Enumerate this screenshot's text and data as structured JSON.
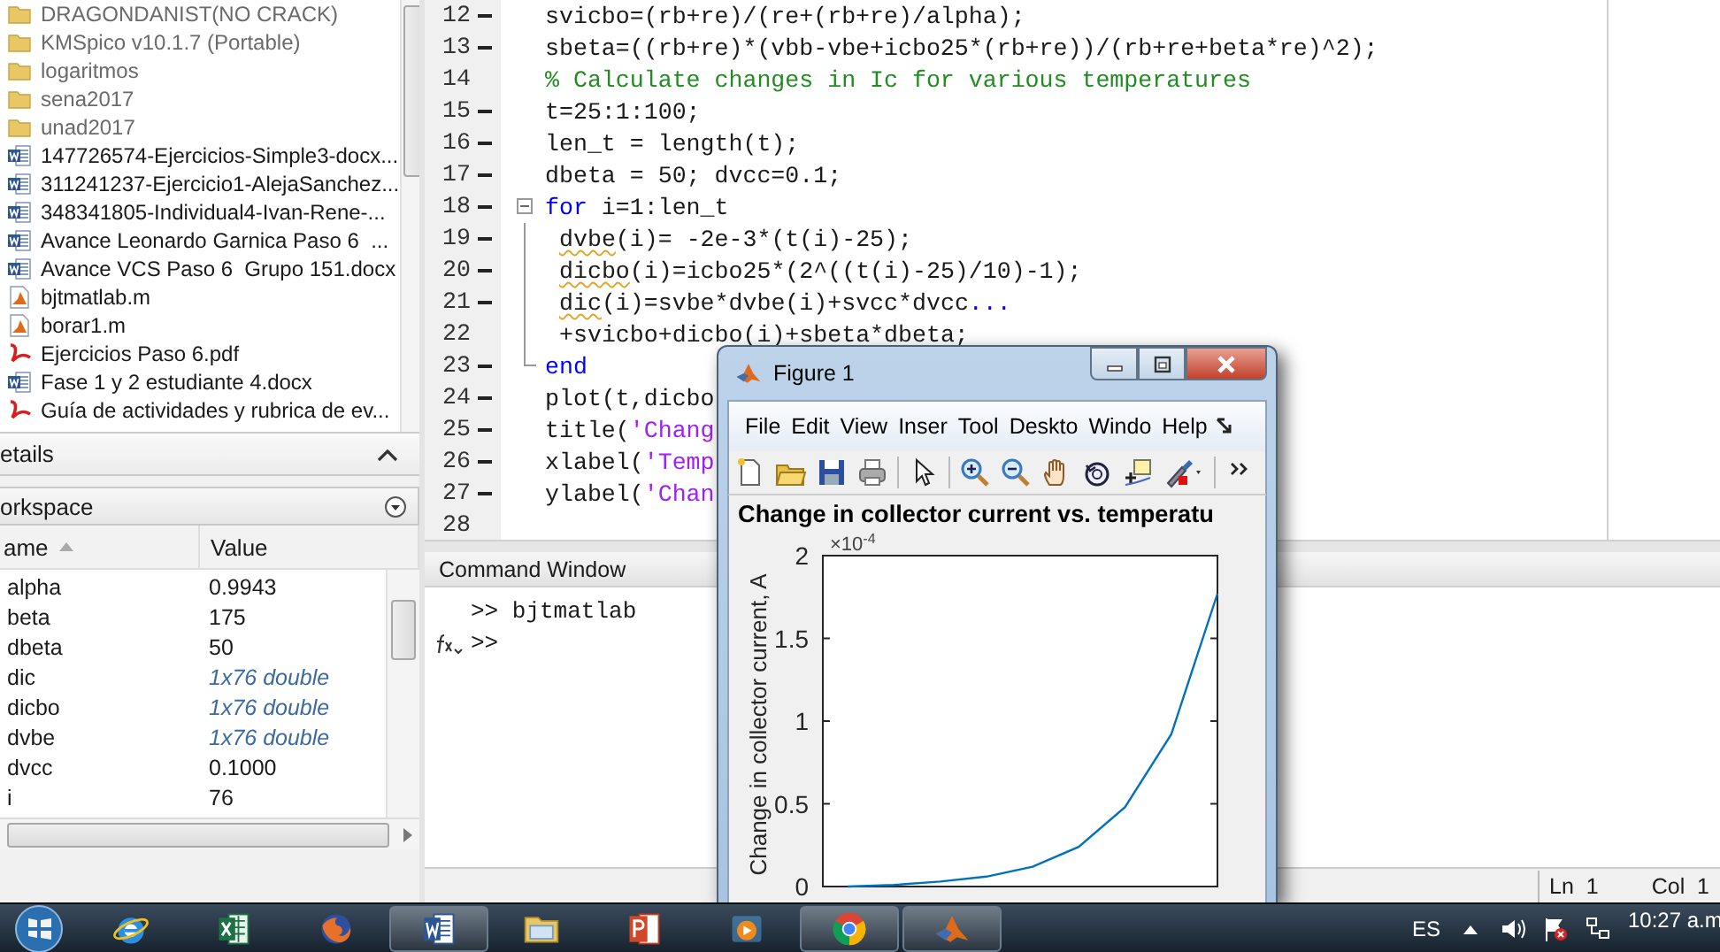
{
  "file_browser": {
    "items": [
      {
        "name": "DRAGONDANIST(NO CRACK)",
        "kind": "folder"
      },
      {
        "name": "KMSpico v10.1.7 (Portable)",
        "kind": "folder"
      },
      {
        "name": "logaritmos",
        "kind": "folder"
      },
      {
        "name": "sena2017",
        "kind": "folder"
      },
      {
        "name": "unad2017",
        "kind": "folder"
      },
      {
        "name": "147726574-Ejercicios-Simple3-docx...",
        "kind": "word"
      },
      {
        "name": "311241237-Ejercicio1-AlejaSanchez...",
        "kind": "word"
      },
      {
        "name": "348341805-Individual4-Ivan-Rene-...",
        "kind": "word"
      },
      {
        "name": "Avance Leonardo Garnica Paso 6  ...",
        "kind": "word"
      },
      {
        "name": "Avance VCS Paso 6  Grupo 151.docx",
        "kind": "word"
      },
      {
        "name": "bjtmatlab.m",
        "kind": "script"
      },
      {
        "name": "borar1.m",
        "kind": "script"
      },
      {
        "name": "Ejercicios Paso 6.pdf",
        "kind": "pdf"
      },
      {
        "name": "Fase 1 y 2 estudiante 4.docx",
        "kind": "word"
      },
      {
        "name": "Guía de actividades y rubrica de ev...",
        "kind": "pdf"
      }
    ]
  },
  "details_panel": {
    "title": "etails"
  },
  "workspace": {
    "title": "orkspace",
    "columns": [
      {
        "label": "ame",
        "sorted": true
      },
      {
        "label": "Value",
        "sorted": false
      }
    ],
    "rows": [
      {
        "name": "alpha",
        "value": "0.9943",
        "kind": "scalar"
      },
      {
        "name": "beta",
        "value": "175",
        "kind": "scalar"
      },
      {
        "name": "dbeta",
        "value": "50",
        "kind": "scalar"
      },
      {
        "name": "dic",
        "value": "1x76 double",
        "kind": "array"
      },
      {
        "name": "dicbo",
        "value": "1x76 double",
        "kind": "array"
      },
      {
        "name": "dvbe",
        "value": "1x76 double",
        "kind": "array"
      },
      {
        "name": "dvcc",
        "value": "0.1000",
        "kind": "scalar"
      },
      {
        "name": "i",
        "value": "76",
        "kind": "scalar"
      }
    ]
  },
  "editor": {
    "lines": [
      {
        "number": "12",
        "executable": true,
        "fold_marker": false,
        "in_block": false,
        "segments": [
          {
            "text": "svicbo=(rb+re)/(re+(rb+re)/alpha);",
            "kind": "plain"
          }
        ]
      },
      {
        "number": "13",
        "executable": true,
        "fold_marker": false,
        "in_block": false,
        "segments": [
          {
            "text": "sbeta=((rb+re)*(vbb-vbe+icbo25*(rb+re))/(rb+re+beta*re)^2);",
            "kind": "plain"
          }
        ]
      },
      {
        "number": "14",
        "executable": false,
        "fold_marker": false,
        "in_block": false,
        "segments": [
          {
            "text": "% Calculate changes in Ic for various temperatures",
            "kind": "comment"
          }
        ]
      },
      {
        "number": "15",
        "executable": true,
        "fold_marker": false,
        "in_block": false,
        "segments": [
          {
            "text": "t=25:1:100;",
            "kind": "plain"
          }
        ]
      },
      {
        "number": "16",
        "executable": true,
        "fold_marker": false,
        "in_block": false,
        "segments": [
          {
            "text": "len_t = length(t);",
            "kind": "plain"
          }
        ]
      },
      {
        "number": "17",
        "executable": true,
        "fold_marker": false,
        "in_block": false,
        "segments": [
          {
            "text": "dbeta = 50; dvcc=0.1;",
            "kind": "plain"
          }
        ]
      },
      {
        "number": "18",
        "executable": true,
        "fold_marker": true,
        "in_block": false,
        "segments": [
          {
            "text": "for",
            "kind": "keyword"
          },
          {
            "text": " i=1:len_t",
            "kind": "plain"
          }
        ]
      },
      {
        "number": "19",
        "executable": true,
        "fold_marker": false,
        "in_block": true,
        "segments": [
          {
            "text": "dvbe",
            "kind": "warning"
          },
          {
            "text": "(i)= -2e-3*(t(i)-25);",
            "kind": "plain"
          }
        ]
      },
      {
        "number": "20",
        "executable": true,
        "fold_marker": false,
        "in_block": true,
        "segments": [
          {
            "text": "dicbo",
            "kind": "warning"
          },
          {
            "text": "(i)=icbo25*(2^((t(i)-25)/10)-1);",
            "kind": "plain"
          }
        ]
      },
      {
        "number": "21",
        "executable": true,
        "fold_marker": false,
        "in_block": true,
        "segments": [
          {
            "text": "dic",
            "kind": "warning"
          },
          {
            "text": "(i)=svbe*dvbe(i)+svcc*dvcc",
            "kind": "plain"
          },
          {
            "text": "...",
            "kind": "keyword"
          }
        ]
      },
      {
        "number": "22",
        "executable": false,
        "fold_marker": false,
        "in_block": true,
        "segments": [
          {
            "text": "+svicbo+dicbo(i)+sbeta*dbeta;",
            "kind": "plain"
          }
        ]
      },
      {
        "number": "23",
        "executable": true,
        "fold_marker": false,
        "in_block": true,
        "segments": [
          {
            "text": "end",
            "kind": "keyword"
          }
        ]
      },
      {
        "number": "24",
        "executable": true,
        "fold_marker": false,
        "in_block": false,
        "segments": [
          {
            "text": "plot(t,dicbo",
            "kind": "plain"
          }
        ]
      },
      {
        "number": "25",
        "executable": true,
        "fold_marker": false,
        "in_block": false,
        "segments": [
          {
            "text": "title(",
            "kind": "plain"
          },
          {
            "text": "'Chang",
            "kind": "string"
          }
        ]
      },
      {
        "number": "26",
        "executable": true,
        "fold_marker": false,
        "in_block": false,
        "segments": [
          {
            "text": "xlabel(",
            "kind": "plain"
          },
          {
            "text": "'Temp",
            "kind": "string"
          }
        ]
      },
      {
        "number": "27",
        "executable": true,
        "fold_marker": false,
        "in_block": false,
        "segments": [
          {
            "text": "ylabel(",
            "kind": "plain"
          },
          {
            "text": "'Chan",
            "kind": "string"
          }
        ]
      },
      {
        "number": "28",
        "executable": false,
        "fold_marker": false,
        "in_block": false
      }
    ]
  },
  "command_window": {
    "title": "Command Window",
    "history": [
      ">> bjtmatlab"
    ],
    "prompt": ">>"
  },
  "status_bar": {
    "line": "Ln  1",
    "column": "Col  1"
  },
  "figure": {
    "title": "Figure 1",
    "menu": [
      "File",
      "Edit",
      "View",
      "Inser",
      "Tool",
      "Deskto",
      "Windo",
      "Help"
    ],
    "y_multiplier": {
      "base": "×10",
      "power": "-4"
    },
    "chart_data": {
      "type": "line",
      "title": "Change in collector current vs. temperatu",
      "ylabel": "Change in collector current, A",
      "categories": [
        null,
        null,
        null,
        null,
        null,
        null,
        null,
        null,
        null
      ],
      "series": [
        {
          "color": "#0072bd",
          "values": [
            0,
            0.01,
            0.03,
            0.06,
            0.12,
            0.24,
            0.48,
            0.92,
            1.77
          ]
        }
      ],
      "ylim": [
        0,
        2
      ],
      "yticks": [
        0,
        0.5,
        1,
        1.5,
        2
      ]
    }
  },
  "taskbar": {
    "apps": [
      {
        "kind": "ie",
        "open": false
      },
      {
        "kind": "excel",
        "open": false
      },
      {
        "kind": "firefox",
        "open": false
      },
      {
        "kind": "word",
        "open": true
      },
      {
        "kind": "explorer",
        "open": false
      },
      {
        "kind": "powerpoint",
        "open": false
      },
      {
        "kind": "media",
        "open": false
      },
      {
        "kind": "chrome",
        "open": true
      },
      {
        "kind": "matlab",
        "open": true
      }
    ],
    "language": "ES",
    "time": "10:27 a.m"
  }
}
